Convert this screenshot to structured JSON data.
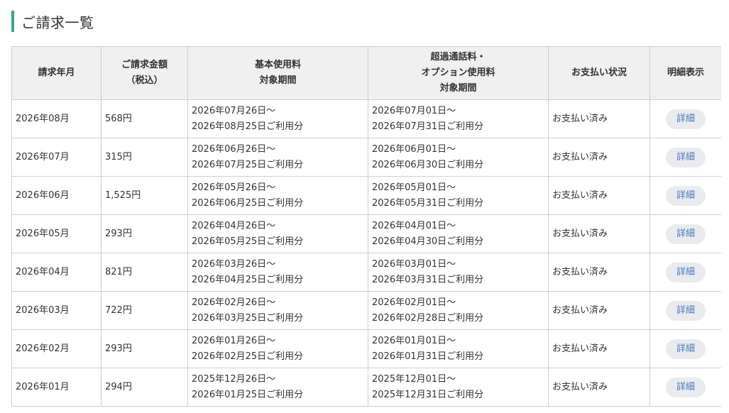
{
  "page": {
    "title": "ご請求一覧"
  },
  "table": {
    "headers": {
      "month": "請求年月",
      "amount_line1": "ご請求金額",
      "amount_line2": "（税込）",
      "basic_line1": "基本使用料",
      "basic_line2": "対象期間",
      "over_line1": "超過通話料・",
      "over_line2": "オプション使用料",
      "over_line3": "対象期間",
      "status": "お支払い状況",
      "detail": "明細表示"
    },
    "rows": [
      {
        "month": "2026年08月",
        "amount": "568円",
        "basic_from": "2026年07月26日～",
        "basic_to": "2026年08月25日ご利用分",
        "over_from": "2026年07月01日～",
        "over_to": "2026年07月31日ご利用分",
        "status": "お支払い済み",
        "detail": "詳細"
      },
      {
        "month": "2026年07月",
        "amount": "315円",
        "basic_from": "2026年06月26日～",
        "basic_to": "2026年07月25日ご利用分",
        "over_from": "2026年06月01日～",
        "over_to": "2026年06月30日ご利用分",
        "status": "お支払い済み",
        "detail": "詳細"
      },
      {
        "month": "2026年06月",
        "amount": "1,525円",
        "basic_from": "2026年05月26日～",
        "basic_to": "2026年06月25日ご利用分",
        "over_from": "2026年05月01日～",
        "over_to": "2026年05月31日ご利用分",
        "status": "お支払い済み",
        "detail": "詳細"
      },
      {
        "month": "2026年05月",
        "amount": "293円",
        "basic_from": "2026年04月26日～",
        "basic_to": "2026年05月25日ご利用分",
        "over_from": "2026年04月01日～",
        "over_to": "2026年04月30日ご利用分",
        "status": "お支払い済み",
        "detail": "詳細"
      },
      {
        "month": "2026年04月",
        "amount": "821円",
        "basic_from": "2026年03月26日～",
        "basic_to": "2026年04月25日ご利用分",
        "over_from": "2026年03月01日～",
        "over_to": "2026年03月31日ご利用分",
        "status": "お支払い済み",
        "detail": "詳細"
      },
      {
        "month": "2026年03月",
        "amount": "722円",
        "basic_from": "2026年02月26日～",
        "basic_to": "2026年03月25日ご利用分",
        "over_from": "2026年02月01日～",
        "over_to": "2026年02月28日ご利用分",
        "status": "お支払い済み",
        "detail": "詳細"
      },
      {
        "month": "2026年02月",
        "amount": "293円",
        "basic_from": "2026年01月26日～",
        "basic_to": "2026年02月25日ご利用分",
        "over_from": "2026年01月01日～",
        "over_to": "2026年01月31日ご利用分",
        "status": "お支払い済み",
        "detail": "詳細"
      },
      {
        "month": "2026年01月",
        "amount": "294円",
        "basic_from": "2025年12月26日～",
        "basic_to": "2026年01月25日ご利用分",
        "over_from": "2025年12月01日～",
        "over_to": "2025年12月31日ご利用分",
        "status": "お支払い済み",
        "detail": "詳細"
      }
    ]
  },
  "colors": {
    "accent": "#3aa68a",
    "header_bg": "#f0f0f0",
    "border": "#cfcfcf",
    "button_bg": "#e9ebee",
    "button_text": "#4a78c0"
  }
}
